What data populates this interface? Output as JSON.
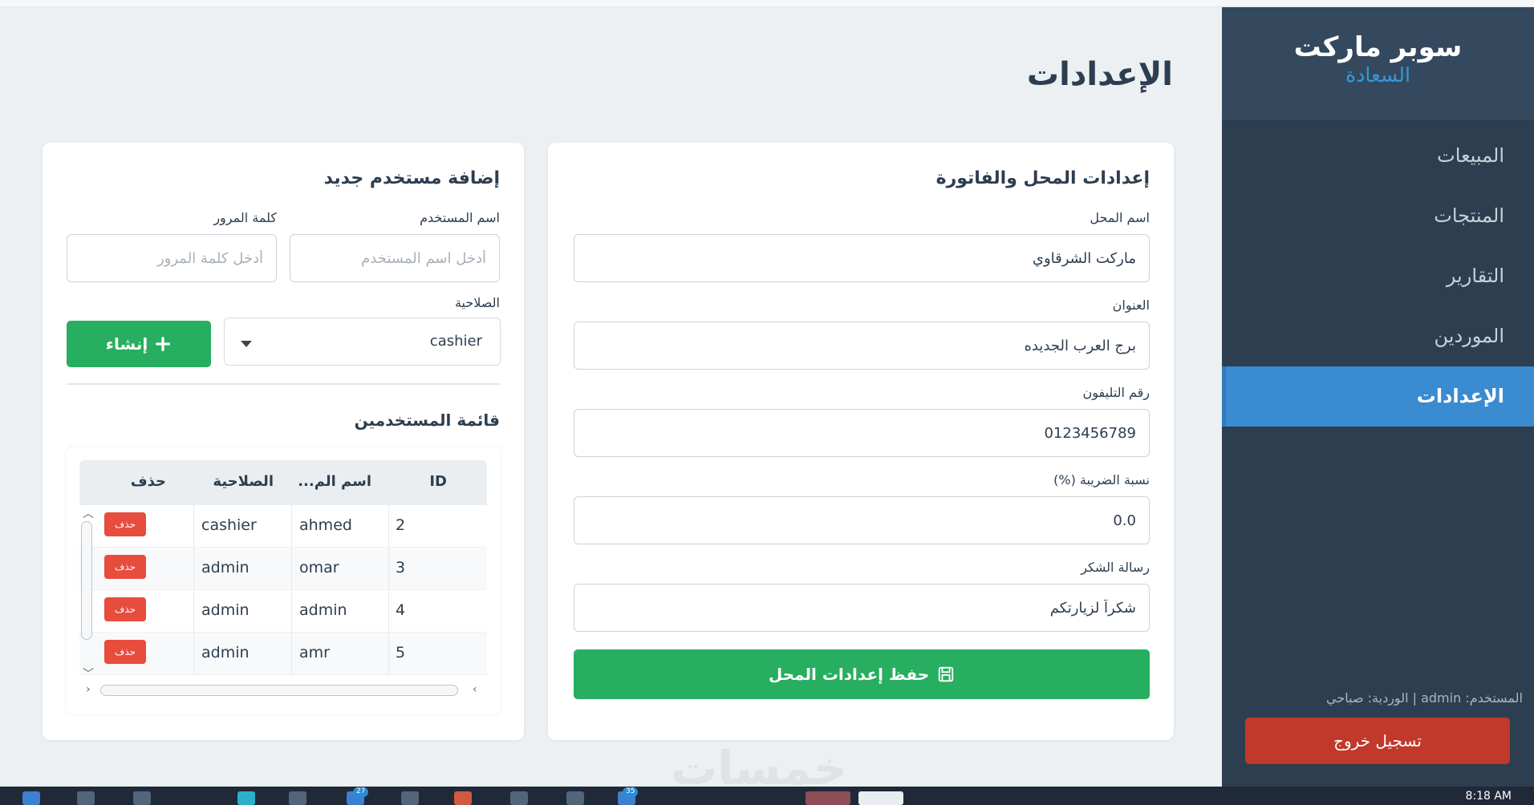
{
  "sidebar": {
    "brand_title": "سوبر ماركت",
    "brand_subtitle": "السعادة",
    "items": [
      {
        "label": "المبيعات"
      },
      {
        "label": "المنتجات"
      },
      {
        "label": "التقارير"
      },
      {
        "label": "الموردين"
      },
      {
        "label": "الإعدادات"
      }
    ],
    "active_item": "الإعدادات",
    "user_info": "المستخدم: admin | الوردية: صباحي",
    "logout_label": "تسجيل خروج"
  },
  "page": {
    "title": "الإعدادات"
  },
  "shop_settings": {
    "title": "إعدادات المحل والفاتورة",
    "fields": [
      {
        "label": "اسم المحل",
        "value": "ماركت الشرقاوي"
      },
      {
        "label": "العنوان",
        "value": "برج العرب الجديده"
      },
      {
        "label": "رقم التليفون",
        "value": "0123456789"
      },
      {
        "label": "نسبة الضريبة (%)",
        "value": "0.0"
      },
      {
        "label": "رسالة الشكر",
        "value": "شكراً لزيارتكم"
      }
    ],
    "save_label": "حفظ إعدادات المحل"
  },
  "new_user": {
    "title": "إضافة مستخدم جديد",
    "username_label": "اسم المستخدم",
    "username_placeholder": "أدخل اسم المستخدم",
    "password_label": "كلمة المرور",
    "password_placeholder": "أدخل كلمة المرور",
    "role_label": "الصلاحية",
    "role_value": "cashier",
    "create_label": "إنشاء"
  },
  "users_list": {
    "title": "قائمة المستخدمين",
    "columns": [
      "ID",
      "اسم الم...",
      "الصلاحية",
      "حذف"
    ],
    "rows": [
      {
        "id": "2",
        "username": "ahmed",
        "role": "cashier",
        "delete_label": "حذف"
      },
      {
        "id": "3",
        "username": "omar",
        "role": "admin",
        "delete_label": "حذف"
      },
      {
        "id": "4",
        "username": "admin",
        "role": "admin",
        "delete_label": "حذف"
      },
      {
        "id": "5",
        "username": "amr",
        "role": "admin",
        "delete_label": "حذف"
      }
    ]
  },
  "watermark": "خمسات",
  "taskbar": {
    "clock": "8:18 AM",
    "badges": [
      "27",
      "35"
    ]
  },
  "colors": {
    "sidebar_bg": "#2d3e50",
    "active_nav": "#3b8bd0",
    "success": "#27ae60",
    "danger": "#e74c3c",
    "logout": "#c0392b",
    "brand_accent": "#3498db"
  },
  "icons": {
    "save": "floppy-disk-icon",
    "create": "plus-icon",
    "dropdown": "caret-down-icon"
  }
}
